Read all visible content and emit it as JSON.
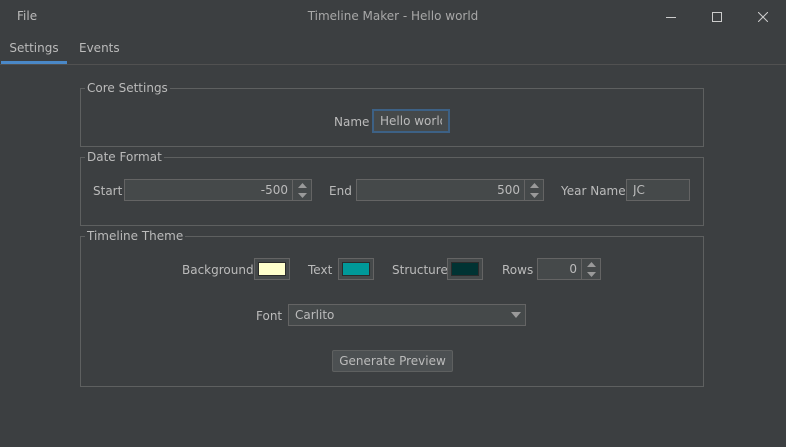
{
  "window": {
    "title": "Timeline Maker - Hello world",
    "menu_file": "File"
  },
  "tabs": [
    {
      "label": "Settings",
      "selected": true
    },
    {
      "label": "Events",
      "selected": false
    }
  ],
  "core_settings": {
    "title": "Core Settings",
    "name_label": "Name",
    "name_value": "Hello world"
  },
  "date_format": {
    "title": "Date Format",
    "start_label": "Start",
    "start_value": "-500",
    "end_label": "End",
    "end_value": "500",
    "year_name_label": "Year Name",
    "year_name_value": "JC"
  },
  "timeline_theme": {
    "title": "Timeline Theme",
    "background_label": "Background",
    "background_color": "#ffffcc",
    "text_label": "Text",
    "text_color": "#009999",
    "structure_label": "Structure",
    "structure_color": "#003333",
    "rows_label": "Rows",
    "rows_value": "0",
    "font_label": "Font",
    "font_value": "Carlito",
    "generate_button": "Generate Preview"
  },
  "colors": {
    "accent": "#4a88c7",
    "window_bg": "#3c3f41",
    "field_bg": "#45494a"
  },
  "icons": {
    "minimize": "minimize-icon",
    "maximize": "maximize-icon",
    "close": "close-icon",
    "spin_up": "triangle-up-icon",
    "spin_down": "triangle-down-icon",
    "dropdown": "chevron-down-icon"
  }
}
